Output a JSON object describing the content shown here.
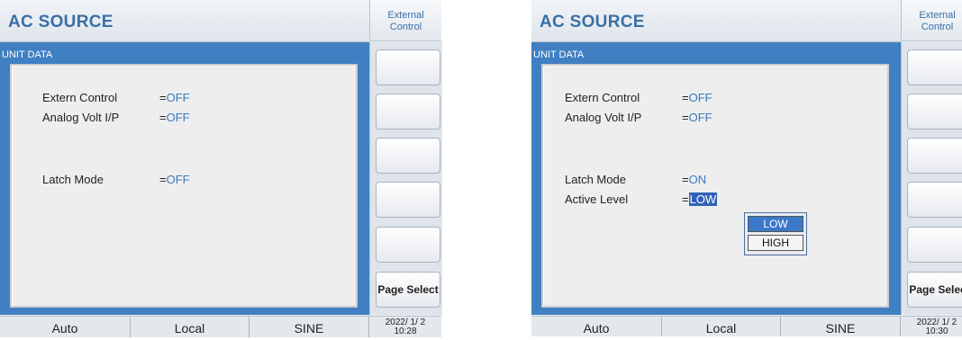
{
  "screens": [
    {
      "app_title": "AC SOURCE",
      "external_control_label": [
        "External",
        "Control"
      ],
      "panel_title": "UNIT DATA",
      "rows": [
        {
          "label": "Extern Control",
          "eq": "=",
          "value": "OFF"
        },
        {
          "label": "Analog Volt I/P",
          "eq": "=",
          "value": "OFF"
        },
        {
          "label": "Latch Mode",
          "eq": "=",
          "value": "OFF"
        }
      ],
      "soft_buttons": [
        "",
        "",
        "",
        "",
        "",
        "Page Select"
      ],
      "status": {
        "mode": "Auto",
        "control": "Local",
        "waveform": "SINE",
        "date": "2022/ 1/ 2",
        "time": "10:28"
      }
    },
    {
      "app_title": "AC SOURCE",
      "external_control_label": [
        "External",
        "Control"
      ],
      "panel_title": "UNIT DATA",
      "rows": [
        {
          "label": "Extern Control",
          "eq": "=",
          "value": "OFF"
        },
        {
          "label": "Analog Volt I/P",
          "eq": "=",
          "value": "OFF"
        },
        {
          "label": "Latch Mode",
          "eq": "=",
          "value": "ON"
        },
        {
          "label": "Active Level",
          "eq": "=",
          "value": "LOW"
        }
      ],
      "soft_buttons": [
        "",
        "",
        "",
        "",
        "",
        "Page Select"
      ],
      "popup_options": [
        "LOW",
        "HIGH"
      ],
      "status": {
        "mode": "Auto",
        "control": "Local",
        "waveform": "SINE",
        "date": "2022/ 1/ 2",
        "time": "10:30"
      }
    }
  ],
  "colors": {
    "accent_blue": "#3f7fc2",
    "value_blue": "#3a78c0",
    "title_blue": "#3a6fa7",
    "selection_blue": "#2f62b7"
  }
}
